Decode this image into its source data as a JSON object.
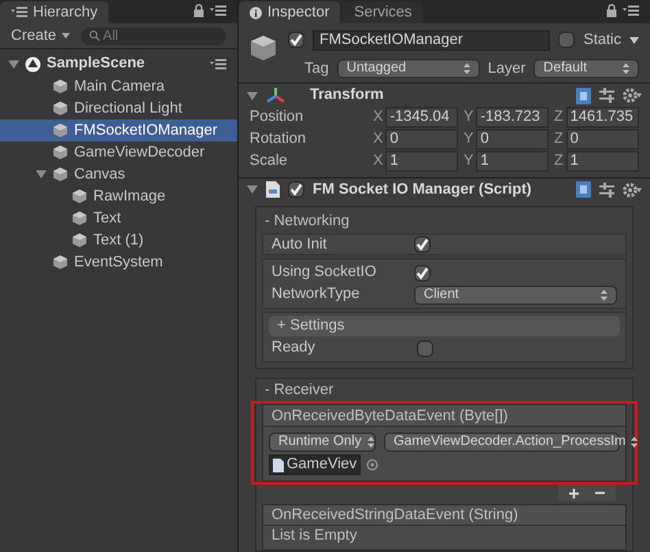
{
  "hierarchy": {
    "tab": "Hierarchy",
    "create": "Create",
    "search": {
      "placeholder": "All"
    },
    "scene": {
      "name": "SampleScene",
      "expanded": true
    },
    "items": [
      {
        "label": "Main Camera",
        "selected": false
      },
      {
        "label": "Directional Light",
        "selected": false
      },
      {
        "label": "FMSocketIOManager",
        "selected": true
      },
      {
        "label": "GameViewDecoder",
        "selected": false
      },
      {
        "label": "Canvas",
        "selected": false,
        "expanded": true,
        "children": [
          {
            "label": "RawImage",
            "selected": false
          },
          {
            "label": "Text",
            "selected": false
          },
          {
            "label": "Text (1)",
            "selected": false
          }
        ]
      },
      {
        "label": "EventSystem",
        "selected": false
      }
    ]
  },
  "inspector": {
    "tabs": [
      {
        "label": "Inspector",
        "selected": true
      },
      {
        "label": "Services",
        "selected": false
      }
    ],
    "object": {
      "active": true,
      "name": "FMSocketIOManager",
      "static_label": "Static",
      "static": false,
      "tag_label": "Tag",
      "tag": "Untagged",
      "layer_label": "Layer",
      "layer": "Default"
    },
    "transform": {
      "title": "Transform",
      "rows": [
        {
          "label": "Position",
          "fields": [
            {
              "axis": "X",
              "value": "-1345.04"
            },
            {
              "axis": "Y",
              "value": "-183.723"
            },
            {
              "axis": "Z",
              "value": "1461.735"
            }
          ]
        },
        {
          "label": "Rotation",
          "fields": [
            {
              "axis": "X",
              "value": "0"
            },
            {
              "axis": "Y",
              "value": "0"
            },
            {
              "axis": "Z",
              "value": "0"
            }
          ]
        },
        {
          "label": "Scale",
          "fields": [
            {
              "axis": "X",
              "value": "1"
            },
            {
              "axis": "Y",
              "value": "1"
            },
            {
              "axis": "Z",
              "value": "1"
            }
          ]
        }
      ]
    },
    "script": {
      "title": "FM Socket IO Manager (Script)",
      "enabled": true
    },
    "networking": {
      "title": "- Networking",
      "auto_init": {
        "label": "Auto Init",
        "checked": true
      },
      "using_socketio": {
        "label": "Using SocketIO",
        "checked": true
      },
      "network_type": {
        "label": "NetworkType",
        "value": "Client"
      },
      "settings": "+ Settings",
      "ready": {
        "label": "Ready",
        "checked": false
      }
    },
    "receiver": {
      "title": "- Receiver",
      "byte_event": {
        "title": "OnReceivedByteDataEvent (Byte[])",
        "mode": "Runtime Only",
        "function": "GameViewDecoder.Action_ProcessIm",
        "target": "GameViev"
      },
      "string_event": {
        "title": "OnReceivedStringDataEvent (String)",
        "empty": "List is Empty"
      }
    }
  }
}
